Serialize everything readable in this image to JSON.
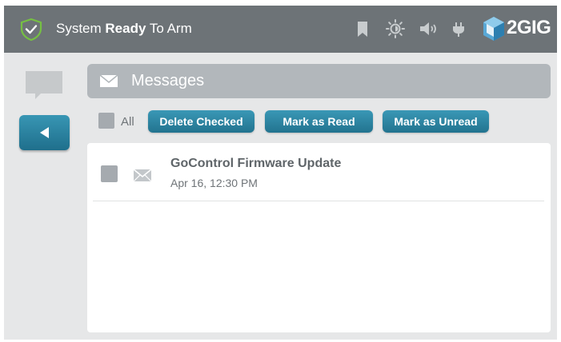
{
  "status_bar": {
    "status_prefix": "System ",
    "status_bold": "Ready",
    "status_suffix": " To Arm",
    "icons": [
      "shield-check-icon",
      "bookmark-icon",
      "brightness-icon",
      "volume-icon",
      "power-plug-icon",
      "2gig-logo-icon"
    ],
    "logo_text": "2GIG"
  },
  "sidebar": {
    "icons": [
      "chat-bubble-icon",
      "back-arrow-icon"
    ]
  },
  "messages_header": {
    "title": "Messages",
    "icon": "envelope-icon"
  },
  "actions": {
    "all_label": "All",
    "delete_checked": "Delete Checked",
    "mark_as_read": "Mark as Read",
    "mark_as_unread": "Mark as Unread"
  },
  "messages": [
    {
      "title": "GoControl Firmware Update",
      "date": "Apr 16, 12:30 PM",
      "checked": false
    }
  ],
  "colors": {
    "topbar": "#6d7377",
    "background": "#e6e7e8",
    "accent": "#2a86a5",
    "shield_green": "#76c043",
    "header_gray": "#b2b7bb"
  }
}
